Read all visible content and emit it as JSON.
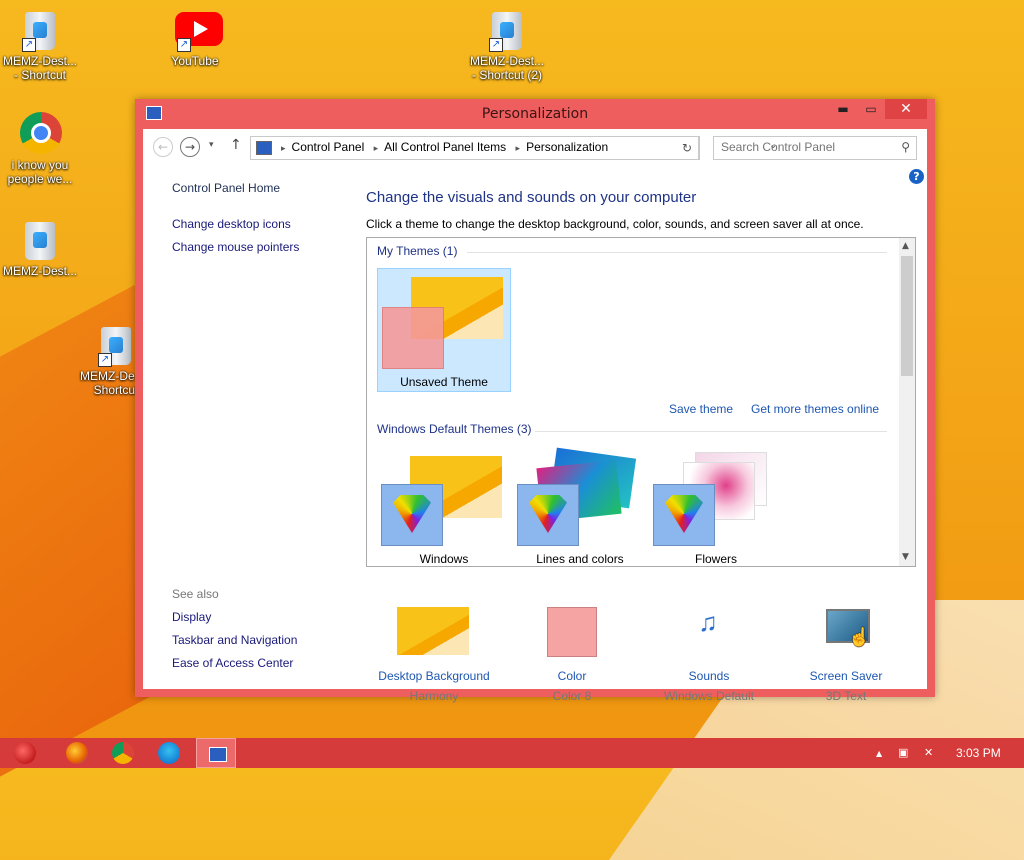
{
  "desktop": {
    "icons": [
      {
        "label": "MEMZ-Dest... - Shortcut"
      },
      {
        "label": "YouTube"
      },
      {
        "label": "MEMZ-Dest... - Shortcut (2)"
      },
      {
        "label": "i know you people we..."
      },
      {
        "label": "MEMZ-Dest..."
      },
      {
        "label": "MEMZ-De... - Shortcut"
      }
    ]
  },
  "window": {
    "title": "Personalization",
    "min_symbol": "▬",
    "max_symbol": "▭",
    "close_symbol": "✕"
  },
  "nav": {
    "back_symbol": "←",
    "forward_symbol": "→",
    "recent_symbol": "▾",
    "up_symbol": "↑",
    "breadcrumbs": [
      "Control Panel",
      "All Control Panel Items",
      "Personalization"
    ],
    "crumb_sep": "▸",
    "dropdown_symbol": "⌄",
    "refresh_symbol": "↻",
    "search_placeholder": "Search Control Panel",
    "search_symbol": "⚲"
  },
  "left_pane": {
    "home": "Control Panel Home",
    "links": [
      "Change desktop icons",
      "Change mouse pointers"
    ],
    "see_also_header": "See also",
    "see_also": [
      "Display",
      "Taskbar and Navigation",
      "Ease of Access Center"
    ]
  },
  "main": {
    "help_symbol": "?",
    "title": "Change the visuals and sounds on your computer",
    "subtitle": "Click a theme to change the desktop background, color, sounds, and screen saver all at once.",
    "my_themes_header": "My Themes (1)",
    "my_themes": [
      {
        "label": "Unsaved Theme",
        "selected": true
      }
    ],
    "save_theme": "Save theme",
    "get_more": "Get more themes online",
    "default_header": "Windows Default Themes (3)",
    "default_themes": [
      {
        "label": "Windows"
      },
      {
        "label": "Lines and colors"
      },
      {
        "label": "Flowers"
      }
    ],
    "scroll_up": "▲",
    "scroll_down": "▼"
  },
  "bottom": [
    {
      "label": "Desktop Background",
      "sub": "Harmony"
    },
    {
      "label": "Color",
      "sub": "Color 8"
    },
    {
      "label": "Sounds",
      "sub": "Windows Default"
    },
    {
      "label": "Screen Saver",
      "sub": "3D Text"
    }
  ],
  "bottom_icons": {
    "sounds": "♫",
    "cursor": "☝"
  },
  "taskbar": {
    "tray_up": "▲",
    "tray_net": "▣",
    "tray_vol": "✕",
    "clock": "3:03 PM"
  },
  "colors": {
    "window_frame": "#ef5e5e",
    "taskbar": "#d63b3b",
    "link": "#1e57b0",
    "heading": "#1e3287"
  }
}
